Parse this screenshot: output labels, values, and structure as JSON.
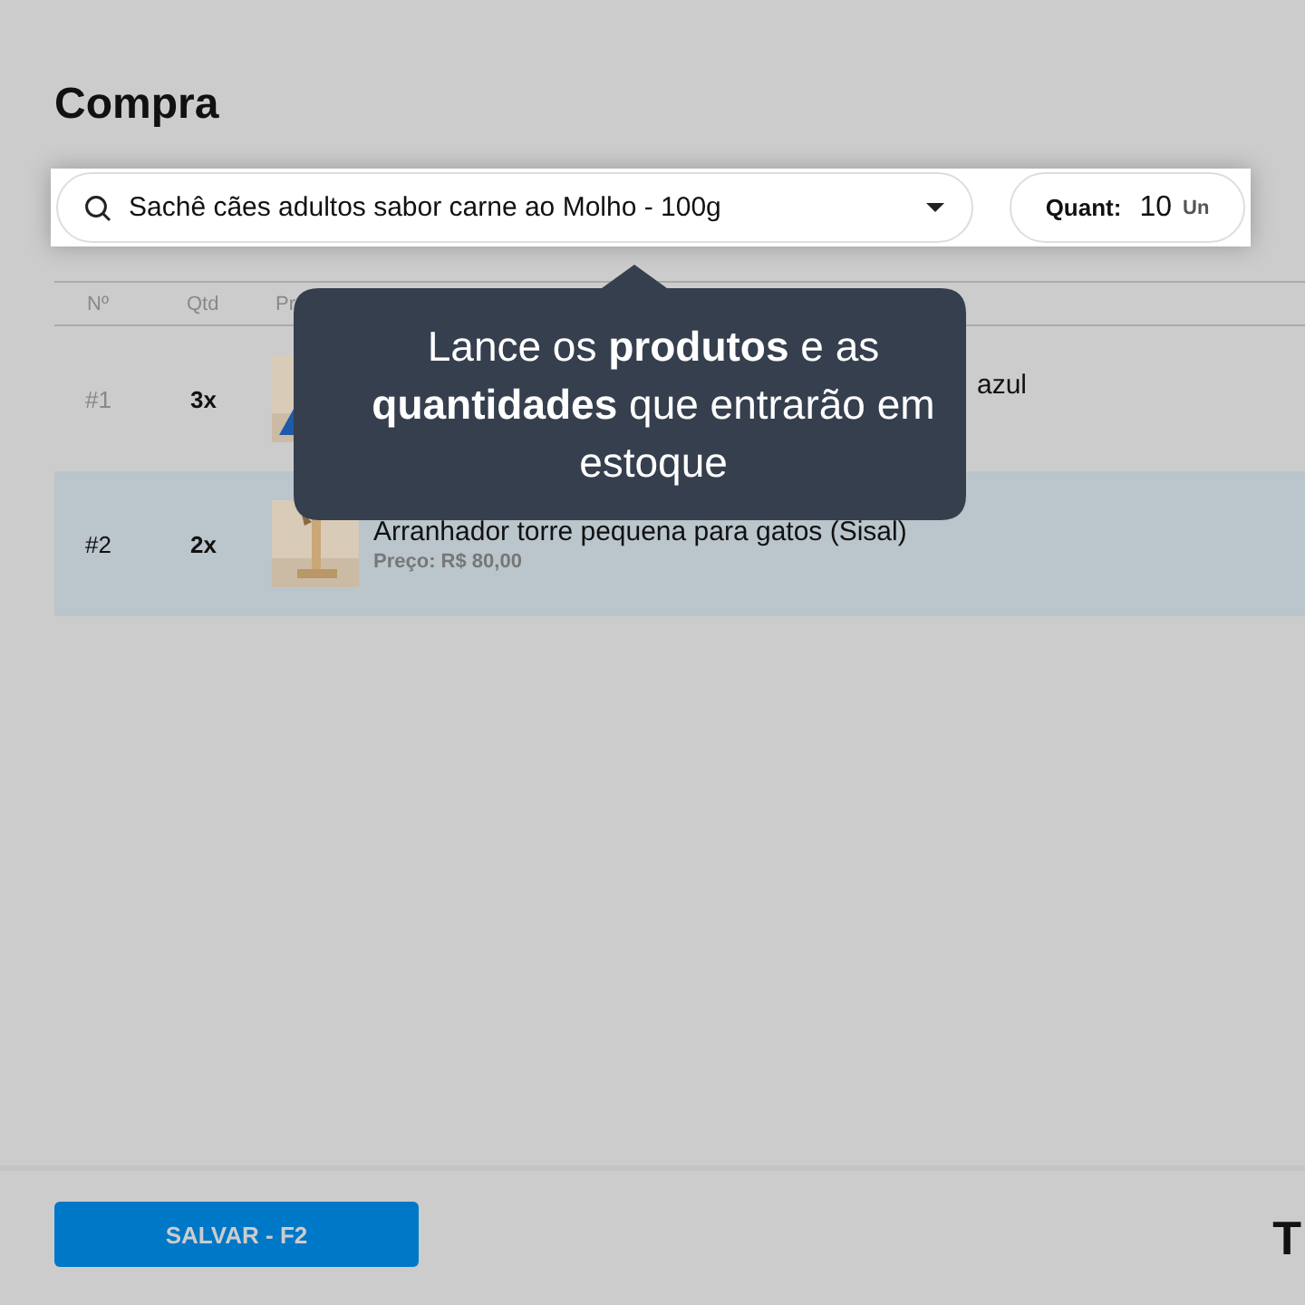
{
  "page": {
    "title": "Compra"
  },
  "search": {
    "value": "Sachê cães adultos sabor carne ao Molho - 100g"
  },
  "quantity": {
    "label": "Quant:",
    "value": "10",
    "unit": "Un"
  },
  "table": {
    "columns": [
      "Nº",
      "Qtd",
      "Pr"
    ],
    "rows": [
      {
        "number": "#1",
        "qty": "3x",
        "name": "azul",
        "selected": false
      },
      {
        "number": "#2",
        "qty": "2x",
        "name": "Arranhador torre pequena para gatos (Sisal)",
        "price": "Preço: R$ 80,00",
        "selected": true
      }
    ]
  },
  "tooltip": {
    "text": "Lance os **produtos** e as **quantidades** que entrarão em estoque"
  },
  "footer": {
    "save_button": "SALVAR - F2",
    "total_label": "T"
  }
}
